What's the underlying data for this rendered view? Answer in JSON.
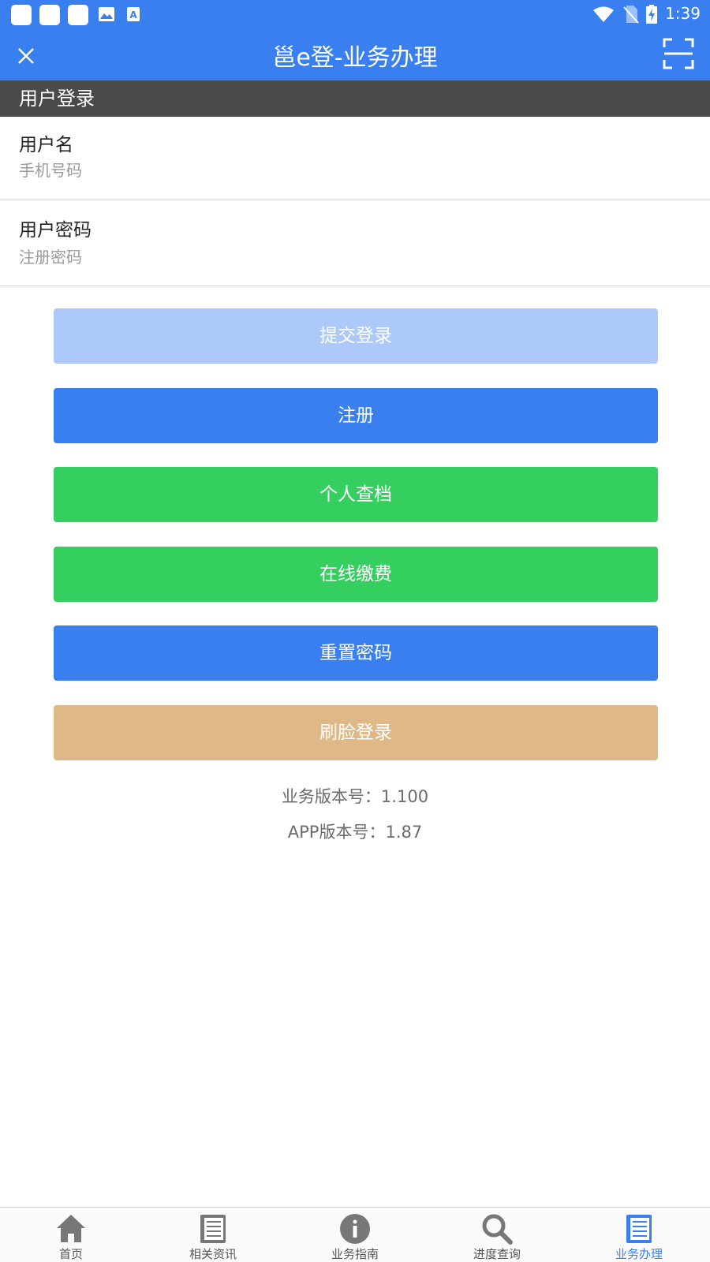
{
  "status_bar": {
    "time": "1:39"
  },
  "app_bar": {
    "title": "邕e登-业务办理"
  },
  "section": {
    "title": "用户登录"
  },
  "form": {
    "username": {
      "label": "用户名",
      "placeholder": "手机号码",
      "value": ""
    },
    "password": {
      "label": "用户密码",
      "placeholder": "注册密码",
      "value": ""
    }
  },
  "buttons": [
    {
      "label": "提交登录",
      "color": "#adc9fa"
    },
    {
      "label": "注册",
      "color": "#3a7ff0"
    },
    {
      "label": "个人查档",
      "color": "#35cf5f"
    },
    {
      "label": "在线缴费",
      "color": "#35cf5f"
    },
    {
      "label": "重置密码",
      "color": "#3a7ff0"
    },
    {
      "label": "刷脸登录",
      "color": "#deb887"
    }
  ],
  "versions": {
    "business": "业务版本号：1.100",
    "app": "APP版本号：1.87"
  },
  "tabs": [
    {
      "label": "首页",
      "icon": "home-icon"
    },
    {
      "label": "相关资讯",
      "icon": "news-icon"
    },
    {
      "label": "业务指南",
      "icon": "info-icon"
    },
    {
      "label": "进度查询",
      "icon": "search-icon"
    },
    {
      "label": "业务办理",
      "icon": "document-icon",
      "active": true
    }
  ],
  "colors": {
    "primary": "#3a7ff0",
    "header_dark": "#4a4a4a",
    "green": "#35cf5f",
    "tan": "#deb887"
  }
}
